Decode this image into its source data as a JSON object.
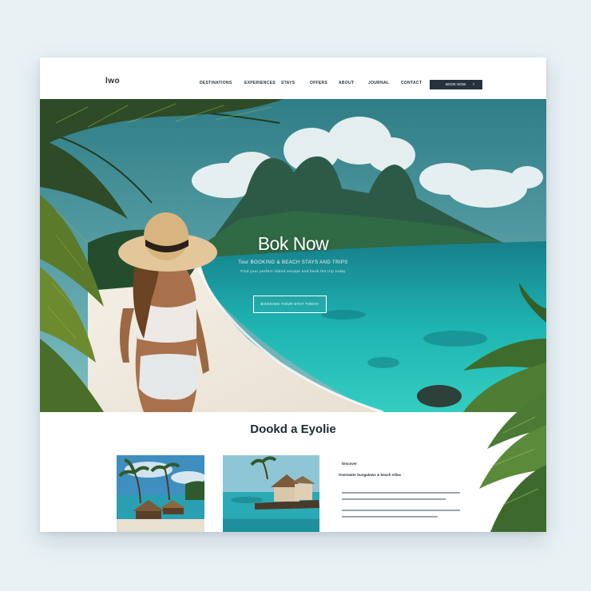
{
  "brand": {
    "logo_text": "lwo"
  },
  "nav": {
    "items": [
      "DESTINATIONS",
      "EXPERIENCES",
      "STAYS",
      "OFFERS",
      "ABOUT",
      "JOURNAL",
      "CONTACT"
    ],
    "button_label": "BOOK NOW",
    "button_arrow": "›"
  },
  "hero": {
    "title": "Bok Now",
    "subtitle": "Tour BOOKING & BEACH STAYS AND TRIPS",
    "tagline": "Find your perfect island escape and book the trip today",
    "cta_label": "BOOKING YOUR STAY TODAY"
  },
  "section": {
    "title": "Dookd a Eyolie",
    "card": {
      "heading": "Discover",
      "subheading": "Overwater bungalows & beach villas"
    }
  },
  "colors": {
    "nav_button_bg": "#26323b",
    "sea": "#1fb0b0",
    "sky": "#3f8f9a",
    "text_dark": "#1c2a33"
  }
}
